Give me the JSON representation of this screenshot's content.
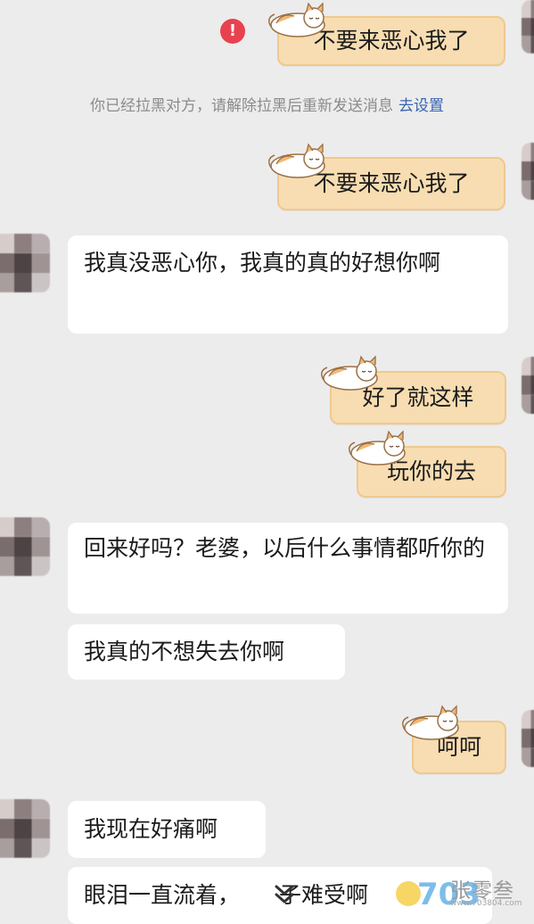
{
  "messages": [
    {
      "id": "m1",
      "side": "out",
      "text": "不要来恶心我了",
      "failed": true
    },
    {
      "id": "m2",
      "side": "out",
      "text": "不要来恶心我了"
    },
    {
      "id": "m3",
      "side": "in",
      "text": "我真没恶心你，我真的真的好想你啊"
    },
    {
      "id": "m4",
      "side": "out",
      "text": "好了就这样"
    },
    {
      "id": "m5",
      "side": "out",
      "text": "玩你的去"
    },
    {
      "id": "m6",
      "side": "in",
      "text": "回来好吗？老婆，以后什么事情都听你的"
    },
    {
      "id": "m7",
      "side": "in",
      "text": "我真的不想失去你啊"
    },
    {
      "id": "m8",
      "side": "out",
      "text": "呵呵"
    },
    {
      "id": "m9",
      "side": "in",
      "text": "我现在好痛啊"
    },
    {
      "id": "m10",
      "side": "in",
      "text": "眼泪一直流着，",
      "text_tail": "子难受啊"
    }
  ],
  "notice": {
    "text": "你已经拉黑对方，请解除拉黑后重新发送消息",
    "link": "去设置"
  },
  "error_badge": "!",
  "watermark": {
    "text": "张零叁",
    "sub": "www.703804.com",
    "logo": "703"
  },
  "icons": {
    "error": "error-icon",
    "cat": "sleeping-cat-sticker",
    "scroll": "chevron-down-icon"
  },
  "colors": {
    "out_bubble": "#f7ddb1",
    "in_bubble": "#ffffff",
    "error": "#e8424e",
    "link": "#3a63b2"
  }
}
